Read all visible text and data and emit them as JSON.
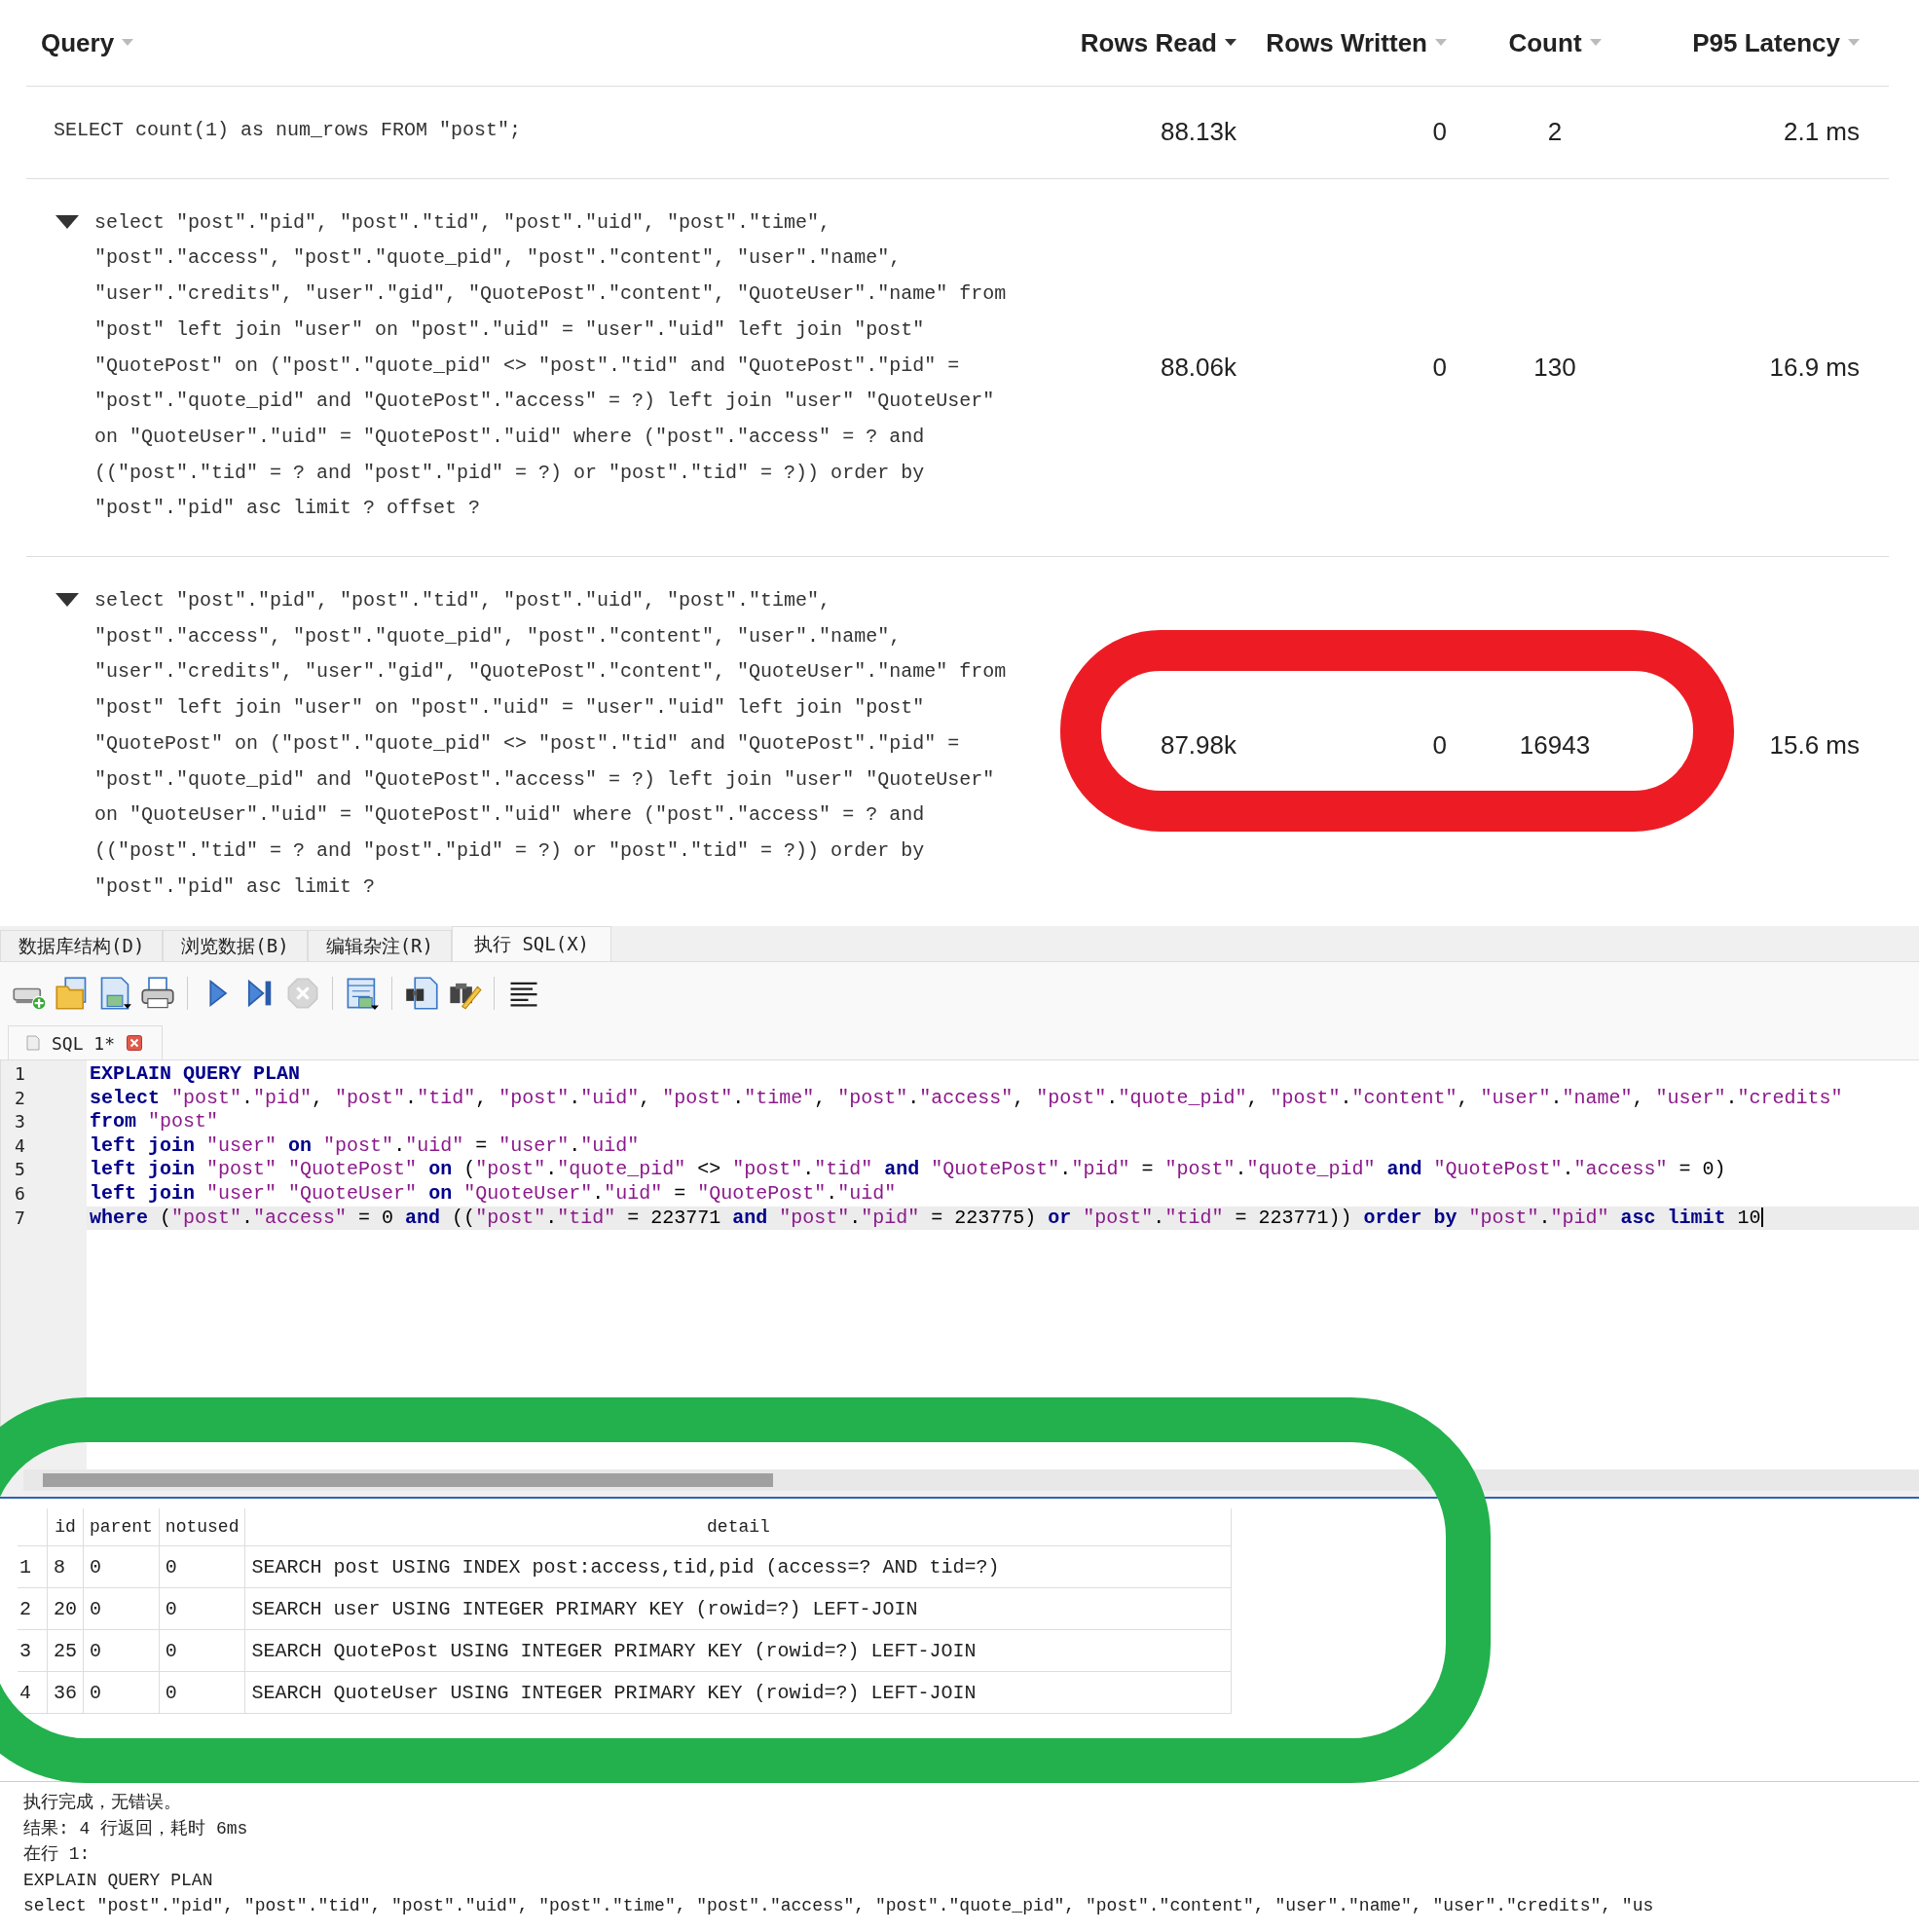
{
  "query_table": {
    "columns": [
      {
        "label": "Query",
        "sorted": false
      },
      {
        "label": "Rows Read",
        "sorted": true
      },
      {
        "label": "Rows Written",
        "sorted": false
      },
      {
        "label": "Count",
        "sorted": false
      },
      {
        "label": "P95 Latency",
        "sorted": false
      }
    ],
    "rows": [
      {
        "kind": "plain",
        "query": "SELECT count(1) as num_rows FROM \"post\";",
        "rows_read": "88.13k",
        "rows_written": "0",
        "count": "2",
        "p95_latency": "2.1 ms"
      },
      {
        "kind": "collapsible",
        "expanded": true,
        "query": "select \"post\".\"pid\", \"post\".\"tid\", \"post\".\"uid\", \"post\".\"time\", \"post\".\"access\", \"post\".\"quote_pid\", \"post\".\"content\", \"user\".\"name\", \"user\".\"credits\", \"user\".\"gid\", \"QuotePost\".\"content\", \"QuoteUser\".\"name\" from \"post\" left join \"user\" on \"post\".\"uid\" = \"user\".\"uid\" left join \"post\" \"QuotePost\" on (\"post\".\"quote_pid\" <> \"post\".\"tid\" and \"QuotePost\".\"pid\" = \"post\".\"quote_pid\" and \"QuotePost\".\"access\" = ?) left join \"user\" \"QuoteUser\" on \"QuoteUser\".\"uid\" = \"QuotePost\".\"uid\" where (\"post\".\"access\" = ? and ((\"post\".\"tid\" = ? and \"post\".\"pid\" = ?) or \"post\".\"tid\" = ?)) order by \"post\".\"pid\" asc limit ? offset ?",
        "rows_read": "88.06k",
        "rows_written": "0",
        "count": "130",
        "p95_latency": "16.9 ms"
      },
      {
        "kind": "collapsible",
        "expanded": true,
        "query": "select \"post\".\"pid\", \"post\".\"tid\", \"post\".\"uid\", \"post\".\"time\", \"post\".\"access\", \"post\".\"quote_pid\", \"post\".\"content\", \"user\".\"name\", \"user\".\"credits\", \"user\".\"gid\", \"QuotePost\".\"content\", \"QuoteUser\".\"name\" from \"post\" left join \"user\" on \"post\".\"uid\" = \"user\".\"uid\" left join \"post\" \"QuotePost\" on (\"post\".\"quote_pid\" <> \"post\".\"tid\" and \"QuotePost\".\"pid\" = \"post\".\"quote_pid\" and \"QuotePost\".\"access\" = ?) left join \"user\" \"QuoteUser\" on \"QuoteUser\".\"uid\" = \"QuotePost\".\"uid\" where (\"post\".\"access\" = ? and ((\"post\".\"tid\" = ? and \"post\".\"pid\" = ?) or \"post\".\"tid\" = ?)) order by \"post\".\"pid\" asc limit ?",
        "rows_read": "87.98k",
        "rows_written": "0",
        "count": "16943",
        "p95_latency": "15.6 ms"
      }
    ]
  },
  "annotations": [
    {
      "color": "#ed1c24"
    },
    {
      "color": "#22b14c"
    }
  ],
  "main_tabs": [
    {
      "label": "数据库结构(D)",
      "selected": false
    },
    {
      "label": "浏览数据(B)",
      "selected": false
    },
    {
      "label": "编辑杂注(R)",
      "selected": false
    },
    {
      "label": "执行 SQL(X)",
      "selected": true
    }
  ],
  "toolbar": [
    {
      "kind": "new",
      "disabled": false
    },
    {
      "kind": "open",
      "disabled": false
    },
    {
      "kind": "save",
      "disabled": false
    },
    {
      "kind": "print",
      "disabled": false
    },
    {
      "kind": "separator"
    },
    {
      "kind": "execute",
      "disabled": false
    },
    {
      "kind": "execute-line",
      "disabled": false
    },
    {
      "kind": "stop",
      "disabled": true
    },
    {
      "kind": "separator"
    },
    {
      "kind": "save-results",
      "disabled": false
    },
    {
      "kind": "separator"
    },
    {
      "kind": "find",
      "disabled": false
    },
    {
      "kind": "find-replace",
      "disabled": false
    },
    {
      "kind": "separator"
    },
    {
      "kind": "comment",
      "disabled": false
    }
  ],
  "editor_tab": {
    "label": "SQL 1*"
  },
  "editor": {
    "lines": [
      {
        "number": "1",
        "current": false,
        "segments": [
          {
            "kind": "keyword",
            "text": "EXPLAIN QUERY PLAN"
          }
        ]
      },
      {
        "number": "2",
        "current": false,
        "segments": [
          {
            "kind": "keyword",
            "text": "select"
          },
          {
            "kind": "code",
            "text": " \"post\".\"pid\", \"post\".\"tid\", \"post\".\"uid\", \"post\".\"time\", \"post\".\"access\", \"post\".\"quote_pid\", \"post\".\"content\", \"user\".\"name\", \"user\".\"credits\""
          }
        ]
      },
      {
        "number": "3",
        "current": false,
        "segments": [
          {
            "kind": "keyword",
            "text": "from"
          },
          {
            "kind": "code",
            "text": " \"post\""
          }
        ]
      },
      {
        "number": "4",
        "current": false,
        "segments": [
          {
            "kind": "keyword",
            "text": "left join"
          },
          {
            "kind": "code",
            "text": " \"user\" "
          },
          {
            "kind": "keyword",
            "text": "on"
          },
          {
            "kind": "code",
            "text": " \"post\".\"uid\" = \"user\".\"uid\""
          }
        ]
      },
      {
        "number": "5",
        "current": false,
        "segments": [
          {
            "kind": "keyword",
            "text": "left join"
          },
          {
            "kind": "code",
            "text": " \"post\" \"QuotePost\" "
          },
          {
            "kind": "keyword",
            "text": "on"
          },
          {
            "kind": "code",
            "text": " (\"post\".\"quote_pid\" <> \"post\".\"tid\" "
          },
          {
            "kind": "keyword",
            "text": "and"
          },
          {
            "kind": "code",
            "text": " \"QuotePost\".\"pid\" = \"post\".\"quote_pid\" "
          },
          {
            "kind": "keyword",
            "text": "and"
          },
          {
            "kind": "code",
            "text": " \"QuotePost\".\"access\" = 0)"
          }
        ]
      },
      {
        "number": "6",
        "current": false,
        "segments": [
          {
            "kind": "keyword",
            "text": "left join"
          },
          {
            "kind": "code",
            "text": " \"user\" \"QuoteUser\" "
          },
          {
            "kind": "keyword",
            "text": "on"
          },
          {
            "kind": "code",
            "text": " \"QuoteUser\".\"uid\" = \"QuotePost\".\"uid\""
          }
        ]
      },
      {
        "number": "7",
        "current": true,
        "segments": [
          {
            "kind": "keyword",
            "text": "where"
          },
          {
            "kind": "code",
            "text": " (\"post\".\"access\" = 0 "
          },
          {
            "kind": "keyword",
            "text": "and"
          },
          {
            "kind": "code",
            "text": " ((\"post\".\"tid\" = 223771 "
          },
          {
            "kind": "keyword",
            "text": "and"
          },
          {
            "kind": "code",
            "text": " \"post\".\"pid\" = 223775) "
          },
          {
            "kind": "keyword",
            "text": "or"
          },
          {
            "kind": "code",
            "text": " \"post\".\"tid\" = 223771)) "
          },
          {
            "kind": "keyword",
            "text": "order by"
          },
          {
            "kind": "code",
            "text": " \"post\".\"pid\" "
          },
          {
            "kind": "keyword",
            "text": "asc limit"
          },
          {
            "kind": "code",
            "text": " 10"
          }
        ]
      }
    ]
  },
  "results": {
    "columns": [
      "id",
      "parent",
      "notused",
      "detail"
    ],
    "rows": [
      {
        "number": "1",
        "cells": [
          "8",
          "0",
          "0",
          "SEARCH post USING INDEX post:access,tid,pid (access=? AND tid=?)"
        ]
      },
      {
        "number": "2",
        "cells": [
          "20",
          "0",
          "0",
          "SEARCH user USING INTEGER PRIMARY KEY (rowid=?) LEFT-JOIN"
        ]
      },
      {
        "number": "3",
        "cells": [
          "25",
          "0",
          "0",
          "SEARCH QuotePost USING INTEGER PRIMARY KEY (rowid=?) LEFT-JOIN"
        ]
      },
      {
        "number": "4",
        "cells": [
          "36",
          "0",
          "0",
          "SEARCH QuoteUser USING INTEGER PRIMARY KEY (rowid=?) LEFT-JOIN"
        ]
      }
    ]
  },
  "messages": [
    "执行完成，无错误。",
    "结果: 4 行返回，耗时 6ms",
    "在行 1:",
    "EXPLAIN QUERY PLAN",
    "select \"post\".\"pid\", \"post\".\"tid\", \"post\".\"uid\", \"post\".\"time\", \"post\".\"access\", \"post\".\"quote_pid\", \"post\".\"content\", \"user\".\"name\", \"user\".\"credits\", \"us"
  ]
}
